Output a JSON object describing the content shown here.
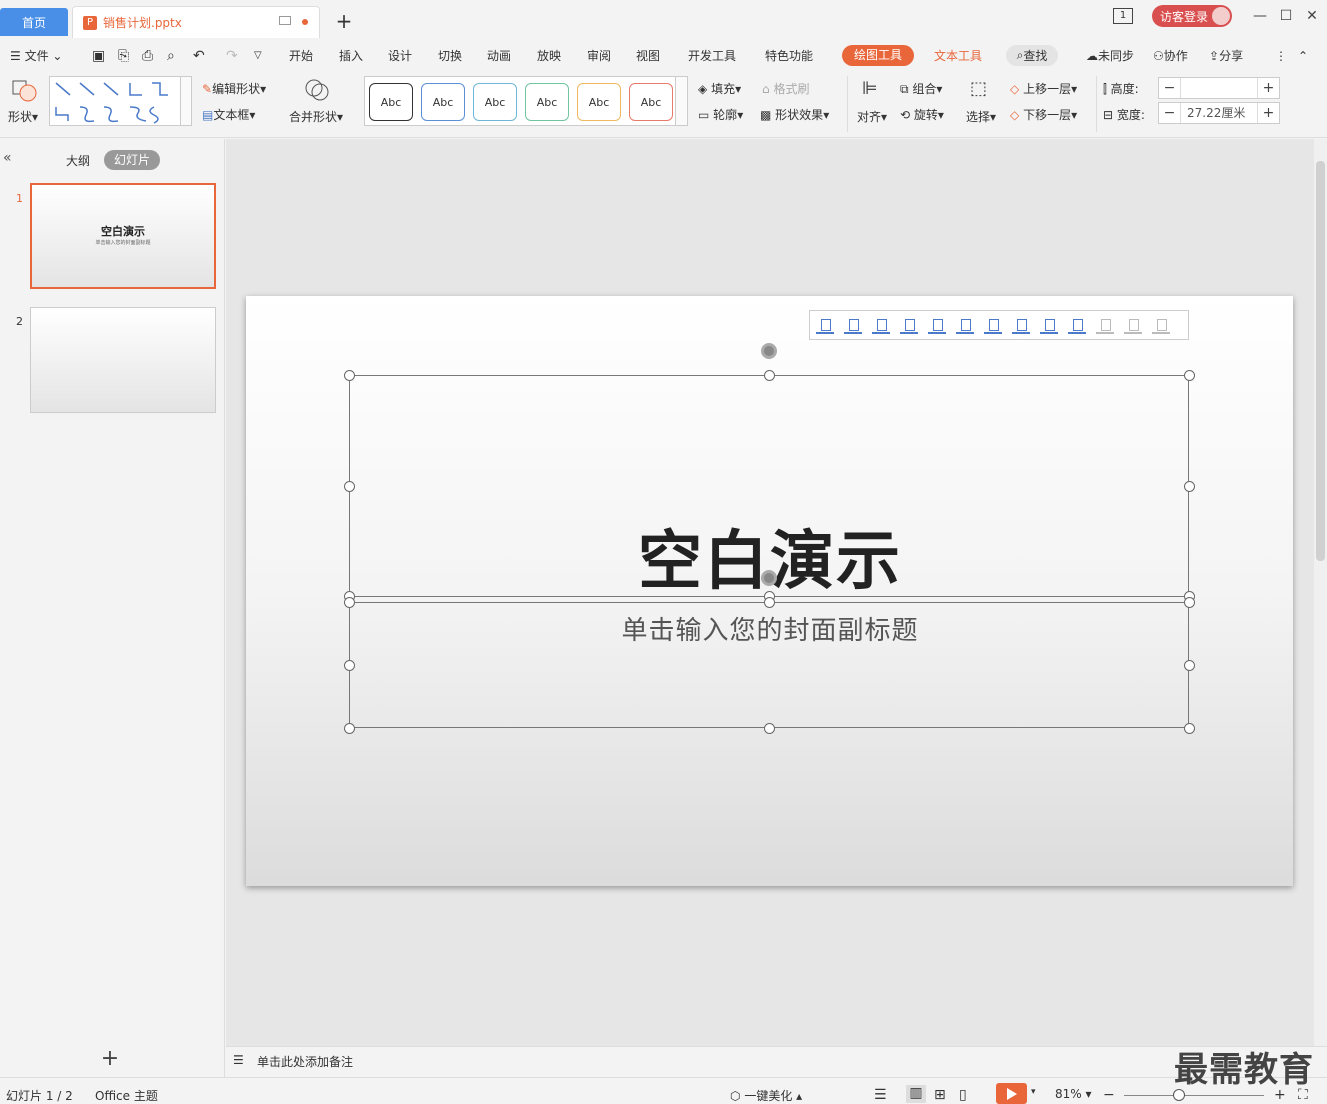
{
  "tabs": {
    "home": "首页",
    "file": "销售计划.pptx"
  },
  "window": {
    "login": "访客登录",
    "page_indicator": "1"
  },
  "menu": {
    "file": "文件",
    "items": [
      "开始",
      "插入",
      "设计",
      "切换",
      "动画",
      "放映",
      "审阅",
      "视图",
      "开发工具",
      "特色功能"
    ],
    "draw_tool": "绘图工具",
    "text_tool": "文本工具",
    "search": "查找",
    "sync": "未同步",
    "collab": "协作",
    "share": "分享"
  },
  "ribbon": {
    "shape": "形状",
    "edit_shape": "编辑形状",
    "text_box": "文本框",
    "merge_shape": "合并形状",
    "style_samples": [
      "Abc",
      "Abc",
      "Abc",
      "Abc",
      "Abc",
      "Abc"
    ],
    "fill": "填充",
    "format_brush": "格式刷",
    "outline": "轮廓",
    "shape_effect": "形状效果",
    "align": "对齐",
    "group": "组合",
    "rotate": "旋转",
    "select": "选择",
    "bring_forward": "上移一层",
    "send_backward": "下移一层",
    "height_label": "高度:",
    "height_value": "",
    "width_label": "宽度:",
    "width_value": "27.22厘米"
  },
  "left_panel": {
    "outline_tab": "大纲",
    "slides_tab": "幻灯片",
    "thumb1_num": "1",
    "thumb1_title": "空白演示",
    "thumb1_sub": "单击输入您的封面副标题",
    "thumb2_num": "2"
  },
  "slide": {
    "title": "空白演示",
    "subtitle": "单击输入您的封面副标题"
  },
  "notes": {
    "placeholder": "单击此处添加备注"
  },
  "status": {
    "slide_count": "幻灯片 1 / 2",
    "theme": "Office 主题",
    "beautify": "一键美化",
    "zoom": "81%"
  },
  "watermark": "最需教育",
  "colors": {
    "accent": "#e8663a",
    "home_tab": "#4a8fe7",
    "login": "#d94f4f",
    "style_borders": [
      "#333333",
      "#5b8fd6",
      "#6fb7d8",
      "#6fc5a0",
      "#f0b860",
      "#e87a6a"
    ]
  }
}
